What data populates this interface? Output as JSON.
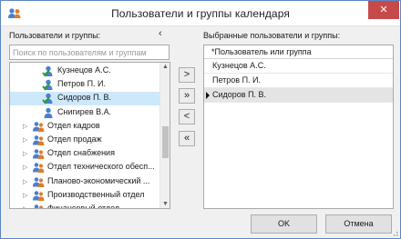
{
  "window": {
    "title": "Пользователи и группы календаря",
    "close_label": "✕"
  },
  "left": {
    "label": "Пользователи и группы:",
    "collapse_glyph": "‹",
    "search_placeholder": "Поиск по пользователям и группам",
    "tree": [
      {
        "label": "Кузнецов А.С.",
        "type": "user",
        "checked": true,
        "selected": false
      },
      {
        "label": "Петров П. И.",
        "type": "user",
        "checked": true,
        "selected": false
      },
      {
        "label": "Сидоров П. В.",
        "type": "user",
        "checked": true,
        "selected": true
      },
      {
        "label": "Снигирев В.А.",
        "type": "user",
        "checked": false,
        "selected": false
      },
      {
        "label": "Отдел кадров",
        "type": "group",
        "expander": "▷"
      },
      {
        "label": "Отдел продаж",
        "type": "group",
        "expander": "▷"
      },
      {
        "label": "Отдел снабжения",
        "type": "group",
        "expander": "▷"
      },
      {
        "label": "Отдел технического обесп...",
        "type": "group",
        "expander": "▷"
      },
      {
        "label": "Планово-экономический ...",
        "type": "group",
        "expander": "▷"
      },
      {
        "label": "Производственный отдел",
        "type": "group",
        "expander": "▷"
      },
      {
        "label": "Финансовый отдел",
        "type": "group",
        "expander": "▷"
      }
    ]
  },
  "move_buttons": {
    "add_one": ">",
    "add_all": "»",
    "remove_one": "<",
    "remove_all": "«"
  },
  "right": {
    "label": "Выбранные пользователи и группы:",
    "column_header": "*Пользователь или группа",
    "rows": [
      {
        "text": "Кузнецов А.С.",
        "current": false
      },
      {
        "text": "Петров П. И.",
        "current": false
      },
      {
        "text": "Сидоров П. В.",
        "current": true
      }
    ]
  },
  "buttons": {
    "ok": "OK",
    "cancel": "Отмена"
  },
  "colors": {
    "accent": "#5b87c4",
    "close": "#c74a4a",
    "selection": "#cde8fb",
    "check": "#2e9a3a"
  },
  "icons": {
    "app": "users-group-icon",
    "user": "user-icon",
    "group": "group-icon"
  }
}
